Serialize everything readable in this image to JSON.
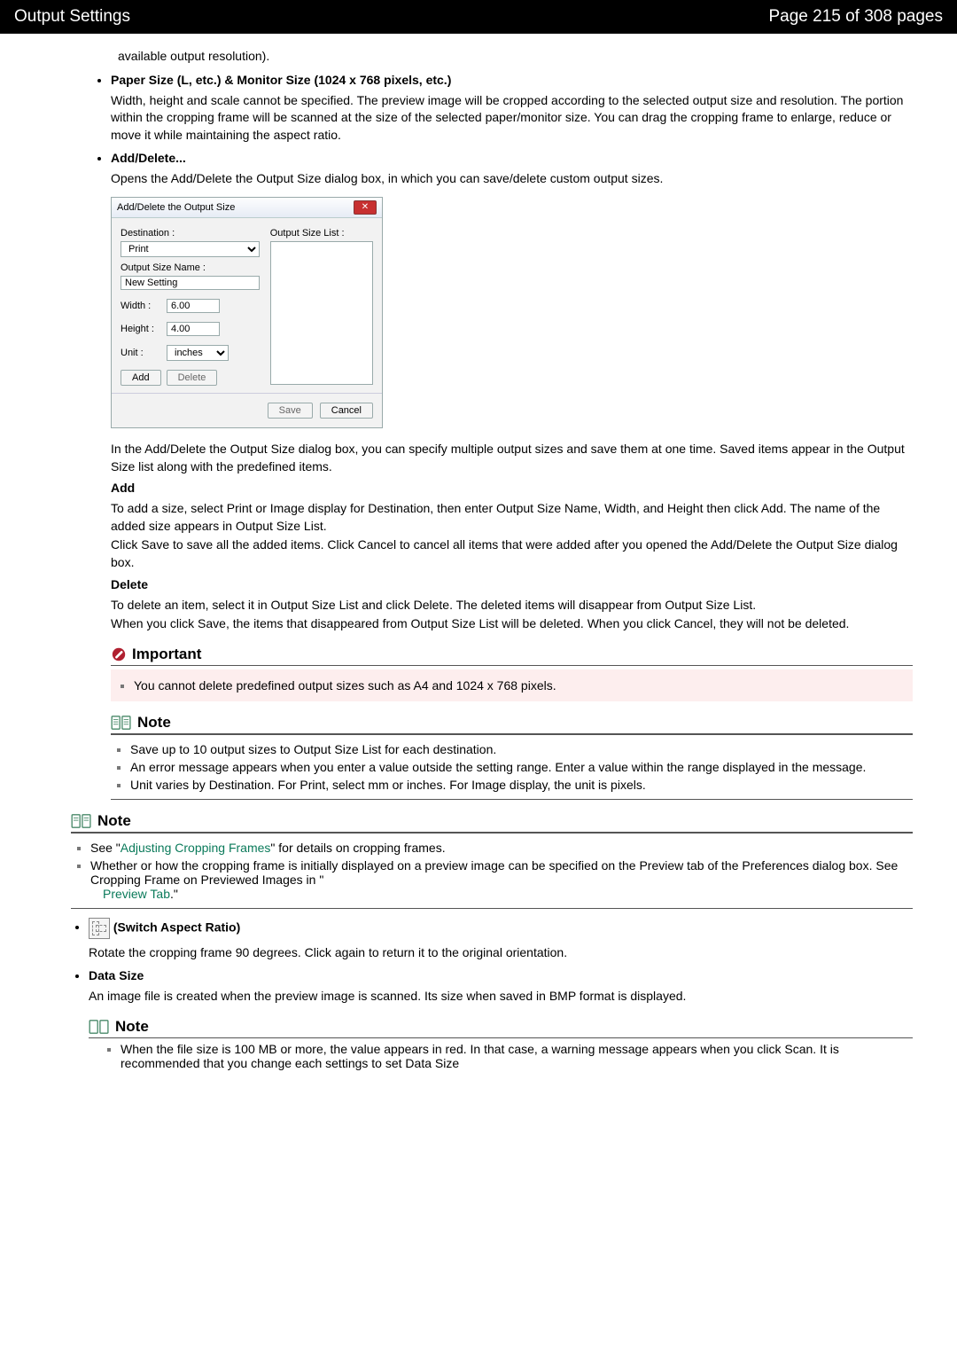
{
  "header": {
    "title": "Output Settings",
    "pager": "Page 215 of 308 pages"
  },
  "intro_tail": "available output resolution).",
  "paper_size": {
    "heading": "Paper Size (L, etc.) & Monitor Size (1024 x 768 pixels, etc.)",
    "body": "Width, height and scale cannot be specified. The preview image will be cropped according to the selected output size and resolution. The portion within the cropping frame will be scanned at the size of the selected paper/monitor size. You can drag the cropping frame to enlarge, reduce or move it while maintaining the aspect ratio."
  },
  "add_delete": {
    "heading": "Add/Delete...",
    "intro": "Opens the Add/Delete the Output Size dialog box, in which you can save/delete custom output sizes.",
    "after_dialog": "In the Add/Delete the Output Size dialog box, you can specify multiple output sizes and save them at one time. Saved items appear in the Output Size list along with the predefined items.",
    "add_h": "Add",
    "add_p1": "To add a size, select Print or Image display for Destination, then enter Output Size Name, Width, and Height then click Add. The name of the added size appears in Output Size List.",
    "add_p2": "Click Save to save all the added items. Click Cancel to cancel all items that were added after you opened the Add/Delete the Output Size dialog box.",
    "del_h": "Delete",
    "del_p1": "To delete an item, select it in Output Size List and click Delete. The deleted items will disappear from Output Size List.",
    "del_p2": "When you click Save, the items that disappeared from Output Size List will be deleted. When you click Cancel, they will not be deleted."
  },
  "dialog": {
    "title": "Add/Delete the Output Size",
    "destination_label": "Destination :",
    "destination_value": "Print",
    "list_label": "Output Size List :",
    "name_label": "Output Size Name :",
    "name_value": "New Setting",
    "width_label": "Width :",
    "width_value": "6.00",
    "height_label": "Height :",
    "height_value": "4.00",
    "unit_label": "Unit :",
    "unit_value": "inches",
    "btn_add": "Add",
    "btn_delete": "Delete",
    "btn_save": "Save",
    "btn_cancel": "Cancel"
  },
  "important": {
    "label": "Important",
    "item": "You cannot delete predefined output sizes such as A4 and 1024 x 768 pixels."
  },
  "note1": {
    "label": "Note",
    "i1": "Save up to 10 output sizes to Output Size List for each destination.",
    "i2": "An error message appears when you enter a value outside the setting range. Enter a value within the range displayed in the message.",
    "i3": "Unit varies by Destination. For Print, select mm or inches. For Image display, the unit is pixels."
  },
  "note2": {
    "label": "Note",
    "i1_pre": "See \"",
    "i1_link": "Adjusting Cropping Frames",
    "i1_post": "\" for details on cropping frames.",
    "i2_pre": "Whether or how the cropping frame is initially displayed on a preview image can be specified on the Preview tab of the Preferences dialog box. See Cropping Frame on Previewed Images in \"",
    "i2_link": "Preview Tab",
    "i2_post": ".\""
  },
  "switch": {
    "heading": "(Switch Aspect Ratio)",
    "body": "Rotate the cropping frame 90 degrees. Click again to return it to the original orientation."
  },
  "data_size": {
    "heading": "Data Size",
    "body": "An image file is created when the preview image is scanned. Its size when saved in BMP format is displayed."
  },
  "note3": {
    "label": "Note",
    "i1": "When the file size is 100 MB or more, the value appears in red. In that case, a warning message appears when you click Scan. It is recommended that you change each settings to set Data Size"
  }
}
